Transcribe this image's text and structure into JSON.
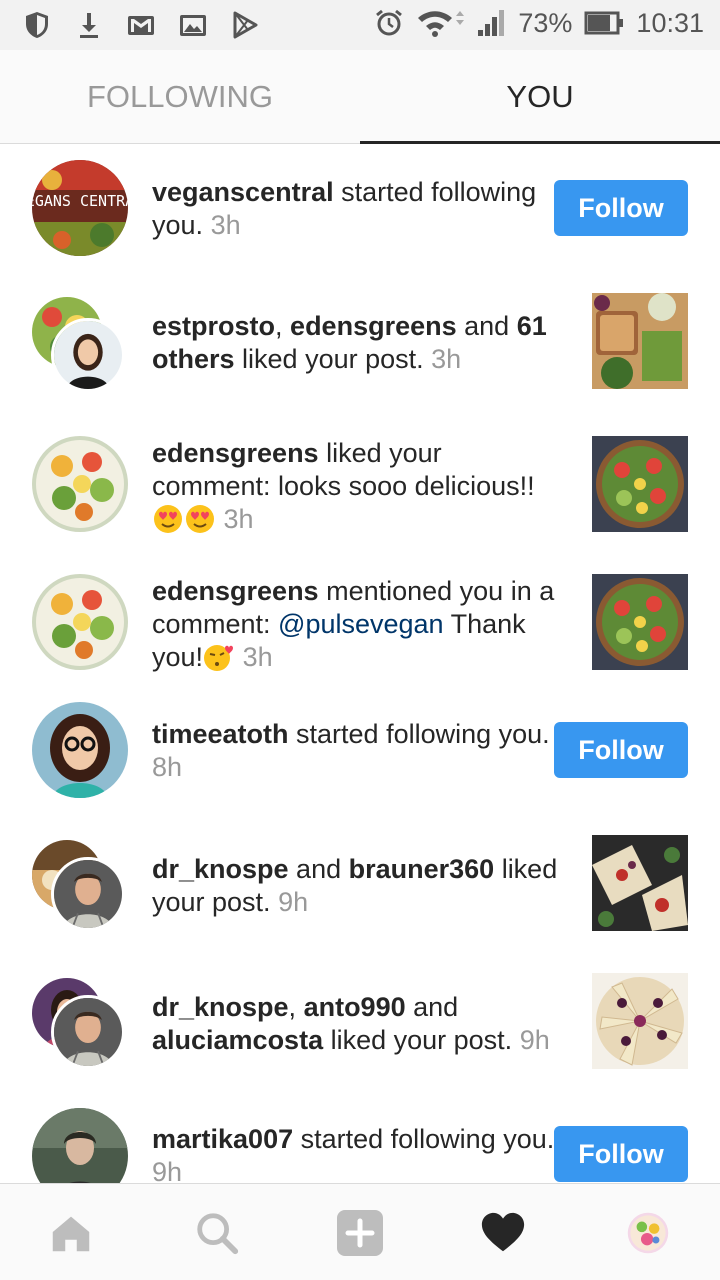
{
  "status_bar": {
    "battery": "73%",
    "time": "10:31",
    "icons_left": [
      "shield-icon",
      "download-icon",
      "gmail-icon",
      "image-icon",
      "play-store-icon"
    ],
    "icons_right": [
      "alarm-icon",
      "wifi-icon",
      "signal-icon",
      "battery-icon"
    ]
  },
  "tabs": {
    "following": "FOLLOWING",
    "you": "YOU",
    "active": "you"
  },
  "activity": [
    {
      "type": "follow",
      "segments": [
        {
          "t": "b",
          "v": "veganscentral"
        },
        {
          "t": "n",
          "v": " started following you."
        }
      ],
      "time": "3h",
      "action": "Follow",
      "avatar_text": "VEGANS CENTRAL"
    },
    {
      "type": "like",
      "segments": [
        {
          "t": "b",
          "v": "estprosto"
        },
        {
          "t": "n",
          "v": ", "
        },
        {
          "t": "b",
          "v": "edensgreens"
        },
        {
          "t": "n",
          "v": " and "
        },
        {
          "t": "b",
          "v": "61 others"
        },
        {
          "t": "n",
          "v": " liked your post."
        }
      ],
      "time": "3h"
    },
    {
      "type": "comment-like",
      "segments": [
        {
          "t": "b",
          "v": "edensgreens"
        },
        {
          "t": "n",
          "v": " liked your comment: looks sooo delicious!!"
        }
      ],
      "emojis": [
        "heart-eyes-emoji",
        "heart-eyes-emoji"
      ],
      "time": "3h"
    },
    {
      "type": "mention",
      "segments": [
        {
          "t": "b",
          "v": "edensgreens"
        },
        {
          "t": "n",
          "v": " mentioned you in a comment: "
        },
        {
          "t": "m",
          "v": "@pulsevegan"
        },
        {
          "t": "n",
          "v": " Thank you!"
        }
      ],
      "emojis": [
        "kissing-heart-emoji"
      ],
      "time": "3h"
    },
    {
      "type": "follow",
      "segments": [
        {
          "t": "b",
          "v": "timeeatoth"
        },
        {
          "t": "n",
          "v": " started following you."
        }
      ],
      "time": "8h",
      "action": "Follow"
    },
    {
      "type": "like",
      "segments": [
        {
          "t": "b",
          "v": "dr_knospe"
        },
        {
          "t": "n",
          "v": " and "
        },
        {
          "t": "b",
          "v": "brauner360"
        },
        {
          "t": "n",
          "v": " liked your post."
        }
      ],
      "time": "9h"
    },
    {
      "type": "like",
      "segments": [
        {
          "t": "b",
          "v": "dr_knospe"
        },
        {
          "t": "n",
          "v": ", "
        },
        {
          "t": "b",
          "v": "anto990"
        },
        {
          "t": "n",
          "v": " and "
        },
        {
          "t": "b",
          "v": "aluciamcosta"
        },
        {
          "t": "n",
          "v": " liked your post."
        }
      ],
      "time": "9h"
    },
    {
      "type": "follow",
      "segments": [
        {
          "t": "b",
          "v": "martika007"
        },
        {
          "t": "n",
          "v": " started following you."
        }
      ],
      "time": "9h",
      "action": "Follow"
    }
  ],
  "bottom_nav": [
    "home-icon",
    "search-icon",
    "add-icon",
    "heart-icon",
    "profile-avatar"
  ],
  "colors": {
    "accent_blue": "#3897f0",
    "mention_blue": "#003569",
    "muted_text": "#999999",
    "primary_text": "#262626"
  }
}
